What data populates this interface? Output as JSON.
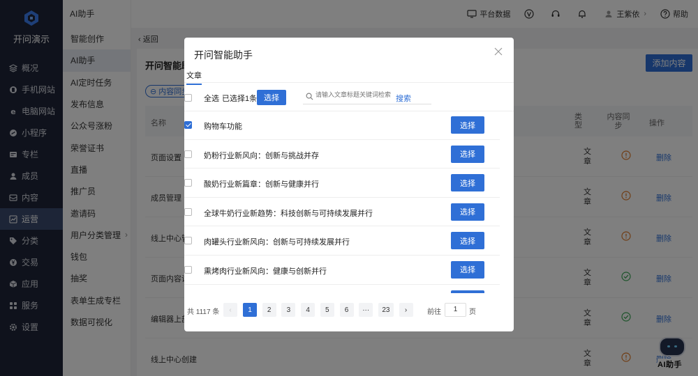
{
  "brand": {
    "name": "开问演示"
  },
  "nav": [
    {
      "label": "概况",
      "icon": "layers-icon"
    },
    {
      "label": "手机网站",
      "icon": "mobile-icon"
    },
    {
      "label": "电脑网站",
      "icon": "ie-icon"
    },
    {
      "label": "小程序",
      "icon": "mini-program-icon"
    },
    {
      "label": "专栏",
      "icon": "column-icon"
    },
    {
      "label": "成员",
      "icon": "user-icon"
    },
    {
      "label": "内容",
      "icon": "content-icon"
    },
    {
      "label": "运营",
      "icon": "chart-icon",
      "active": true
    },
    {
      "label": "分类",
      "icon": "tag-icon"
    },
    {
      "label": "交易",
      "icon": "yen-icon"
    },
    {
      "label": "应用",
      "icon": "cube-icon"
    },
    {
      "label": "服务",
      "icon": "grid-icon"
    },
    {
      "label": "设置",
      "icon": "gear-icon"
    }
  ],
  "submenu": {
    "title": "AI助手",
    "items": [
      {
        "label": "智能创作"
      },
      {
        "label": "AI助手",
        "active": true
      },
      {
        "label": "AI定时任务"
      },
      {
        "label": "发布信息"
      },
      {
        "label": "公众号涨粉"
      },
      {
        "label": "荣誉证书"
      },
      {
        "label": "直播"
      },
      {
        "label": "推广员"
      },
      {
        "label": "邀请码"
      },
      {
        "label": "用户分类管理",
        "chevron": "›"
      },
      {
        "label": "钱包"
      },
      {
        "label": "抽奖"
      },
      {
        "label": "表单生成专栏"
      },
      {
        "label": "数据可视化"
      }
    ]
  },
  "topbar": {
    "platform_data": "平台数据",
    "user": "王紫依",
    "user_chevron": "›",
    "help": "帮助"
  },
  "page": {
    "back": "返回",
    "title": "开问智能助",
    "add_button": "添加内容",
    "sync_chip": "内容同步",
    "columns": {
      "name": "名称",
      "type": "类型",
      "sync": "内容同步",
      "op": "操作"
    },
    "rows": [
      {
        "name": "页面设置",
        "type": "文章",
        "status": "warn",
        "op": "删除"
      },
      {
        "name": "成员管理",
        "type": "文章",
        "status": "warn",
        "op": "删除"
      },
      {
        "name": "线上中心管",
        "type": "文章",
        "status": "warn",
        "op": "删除"
      },
      {
        "name": "页面内容设",
        "type": "文章",
        "status": "ok",
        "op": "删除"
      },
      {
        "name": "编辑器上部",
        "type": "文章",
        "status": "ok",
        "op": "删除"
      },
      {
        "name": "线上中心创建",
        "type": "文章",
        "status": "warn",
        "op": "删除"
      }
    ],
    "colors": {
      "accent": "#2f6fd6",
      "warn": "#e07b2a",
      "ok": "#3aa655"
    }
  },
  "modal": {
    "title": "开问智能助手",
    "tab": "文章",
    "select_all": "全选",
    "selected_count": "已选择1条",
    "select_button": "选择",
    "search_placeholder": "请输入文章标题关键词检索",
    "search_button": "搜索",
    "items": [
      {
        "title": "购物车功能",
        "checked": true,
        "button": "选择"
      },
      {
        "title": "奶粉行业新风向：创新与挑战并存",
        "checked": false,
        "button": "选择"
      },
      {
        "title": "酸奶行业新篇章：创新与健康并行",
        "checked": false,
        "button": "选择"
      },
      {
        "title": "全球牛奶行业新趋势：科技创新与可持续发展并行",
        "checked": false,
        "button": "选择"
      },
      {
        "title": "肉罐头行业新风向：创新与可持续发展并行",
        "checked": false,
        "button": "选择"
      },
      {
        "title": "熏烤肉行业新风向：健康与创新并行",
        "checked": false,
        "button": "选择"
      }
    ],
    "pager": {
      "total": "共 1117 条",
      "prev": "‹",
      "pages": [
        "1",
        "2",
        "3",
        "4",
        "5",
        "6",
        "···",
        "23"
      ],
      "current": "1",
      "next": "›",
      "goto_label": "前往",
      "goto_value": "1",
      "goto_suffix": "页"
    }
  },
  "bot": {
    "label": "AI助手"
  }
}
